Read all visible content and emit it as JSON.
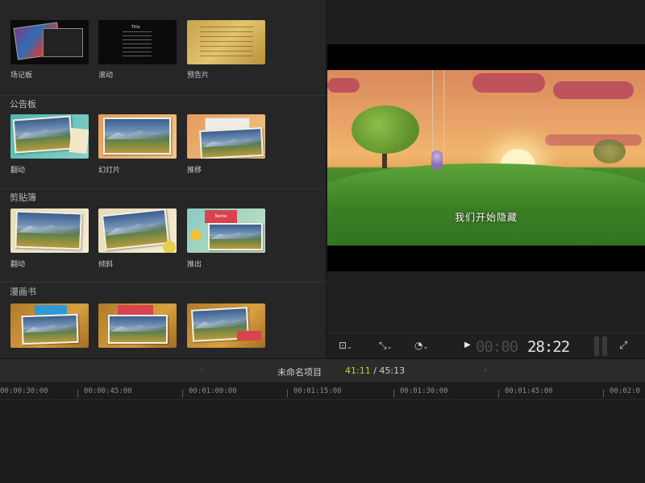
{
  "browser": {
    "row1": {
      "items": [
        {
          "label": "场记板"
        },
        {
          "label": "滚动"
        },
        {
          "label": "预告片"
        }
      ],
      "scroll_title": "Title"
    },
    "sections": [
      {
        "title": "公告板",
        "items": [
          {
            "label": "翻动"
          },
          {
            "label": "幻灯片"
          },
          {
            "label": "推移"
          }
        ]
      },
      {
        "title": "剪贴簿",
        "items": [
          {
            "label": "翻动"
          },
          {
            "label": "倾斜"
          },
          {
            "label": "推出"
          }
        ],
        "badge": "Name"
      },
      {
        "title": "漫画书",
        "items": [
          {
            "label": ""
          },
          {
            "label": ""
          },
          {
            "label": ""
          }
        ]
      }
    ]
  },
  "viewer": {
    "subtitle": "我们开始隐藏",
    "timecode_dim": "00:00",
    "timecode_main": "28:22",
    "icons": {
      "layout": "viewer-layout-icon",
      "transform": "transform-tool-icon",
      "speed": "speed-icon",
      "play": "play-icon",
      "fullscreen": "fullscreen-icon"
    }
  },
  "timeline": {
    "project_name": "未命名项目",
    "current_time": "41:11",
    "total_time": "45:13",
    "ruler": [
      "00:00:30:00",
      "00:00:45:00",
      "00:01:00:00",
      "00:01:15:00",
      "00:01:30:00",
      "00:01:45:00",
      "00:02:0"
    ]
  },
  "colors": {
    "accent_timecode": "#b8d432",
    "background": "#1e1e1f"
  }
}
